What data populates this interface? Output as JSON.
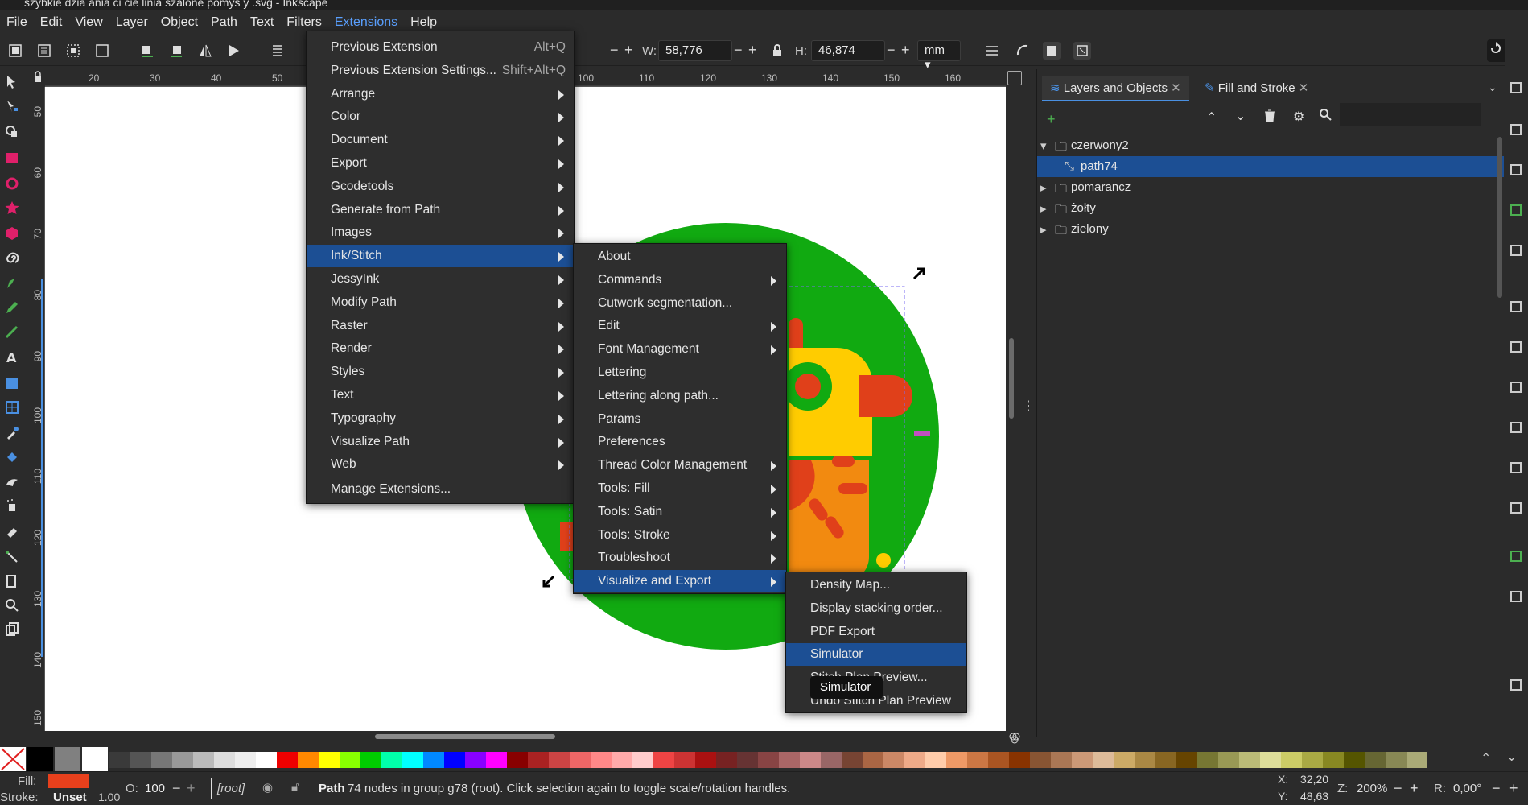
{
  "window": {
    "title": "szybkie dzia ania  ci cie  linia  szalone pomys y .svg - Inkscape"
  },
  "menubar": [
    "File",
    "Edit",
    "View",
    "Layer",
    "Object",
    "Path",
    "Text",
    "Filters",
    "Extensions",
    "Help"
  ],
  "toolbar": {
    "w_label": "W:",
    "w_value": "58,776",
    "h_label": "H:",
    "h_value": "46,874",
    "unit": "mm"
  },
  "ruler": {
    "h_ticks": [
      "20",
      "30",
      "40",
      "50",
      "100",
      "110",
      "120",
      "130",
      "140",
      "150",
      "160"
    ],
    "v_ticks": [
      "50",
      "60",
      "70",
      "80",
      "90",
      "100",
      "110",
      "120",
      "130",
      "140",
      "150"
    ]
  },
  "extensions_menu": {
    "items": [
      {
        "label": "Previous Extension",
        "shortcut": "Alt+Q",
        "submenu": false
      },
      {
        "label": "Previous Extension Settings...",
        "shortcut": "Shift+Alt+Q",
        "submenu": false
      },
      {
        "label": "Arrange",
        "submenu": true
      },
      {
        "label": "Color",
        "submenu": true
      },
      {
        "label": "Document",
        "submenu": true
      },
      {
        "label": "Export",
        "submenu": true
      },
      {
        "label": "Gcodetools",
        "submenu": true
      },
      {
        "label": "Generate from Path",
        "submenu": true
      },
      {
        "label": "Images",
        "submenu": true
      },
      {
        "label": "Ink/Stitch",
        "submenu": true,
        "highlighted": true
      },
      {
        "label": "JessyInk",
        "submenu": true
      },
      {
        "label": "Modify Path",
        "submenu": true
      },
      {
        "label": "Raster",
        "submenu": true
      },
      {
        "label": "Render",
        "submenu": true
      },
      {
        "label": "Styles",
        "submenu": true
      },
      {
        "label": "Text",
        "submenu": true
      },
      {
        "label": "Typography",
        "submenu": true
      },
      {
        "label": "Visualize Path",
        "submenu": true
      },
      {
        "label": "Web",
        "submenu": true
      },
      {
        "label": "Manage Extensions...",
        "submenu": false
      }
    ]
  },
  "inkstitch_menu": {
    "items": [
      {
        "label": "About",
        "submenu": false
      },
      {
        "label": "Commands",
        "submenu": true
      },
      {
        "label": "Cutwork segmentation...",
        "submenu": false
      },
      {
        "label": "Edit",
        "submenu": true
      },
      {
        "label": "Font Management",
        "submenu": true
      },
      {
        "label": "Lettering",
        "submenu": false
      },
      {
        "label": "Lettering along path...",
        "submenu": false
      },
      {
        "label": "Params",
        "submenu": false
      },
      {
        "label": "Preferences",
        "submenu": false
      },
      {
        "label": "Thread Color Management",
        "submenu": true
      },
      {
        "label": "Tools: Fill",
        "submenu": true
      },
      {
        "label": "Tools: Satin",
        "submenu": true
      },
      {
        "label": "Tools: Stroke",
        "submenu": true
      },
      {
        "label": "Troubleshoot",
        "submenu": true
      },
      {
        "label": "Visualize and Export",
        "submenu": true,
        "highlighted": true
      }
    ]
  },
  "visualize_menu": {
    "items": [
      {
        "label": "Density Map..."
      },
      {
        "label": "Display stacking order..."
      },
      {
        "label": "PDF Export"
      },
      {
        "label": "Simulator",
        "highlighted": true
      },
      {
        "label": "Stitch Plan Preview..."
      },
      {
        "label": "Undo Stitch Plan Preview"
      }
    ]
  },
  "tooltip": "Simulator",
  "panel": {
    "tabs": [
      "Layers and Objects",
      "Fill and Stroke"
    ],
    "tree": [
      {
        "label": "czerwony2",
        "expanded": true,
        "type": "layer"
      },
      {
        "label": "path74",
        "type": "path",
        "selected": true
      },
      {
        "label": "pomarancz",
        "type": "layer"
      },
      {
        "label": "żołty",
        "type": "layer"
      },
      {
        "label": "zielony",
        "type": "layer"
      }
    ]
  },
  "statusbar": {
    "fill_label": "Fill:",
    "stroke_label": "Stroke:",
    "stroke_value": "Unset",
    "stroke_width": "1.00",
    "opacity_label": "O:",
    "opacity_value": "100",
    "layer": "[root]",
    "message_bold": "Path",
    "message": " 74 nodes in group g78 (root). Click selection again to toggle scale/rotation handles.",
    "x_label": "X:",
    "x_value": "32,20",
    "y_label": "Y:",
    "y_value": "48,63",
    "zoom_label": "Z:",
    "zoom_value": "200%",
    "rotation_label": "R:",
    "rotation_value": "0,00°"
  },
  "colors": {
    "accent": "#1c4f94",
    "fill_swatch": "#e8401c",
    "circle_green": "#11aa11",
    "yellow": "#ffcc00",
    "orange": "#f28a10",
    "red": "#e0401a"
  }
}
